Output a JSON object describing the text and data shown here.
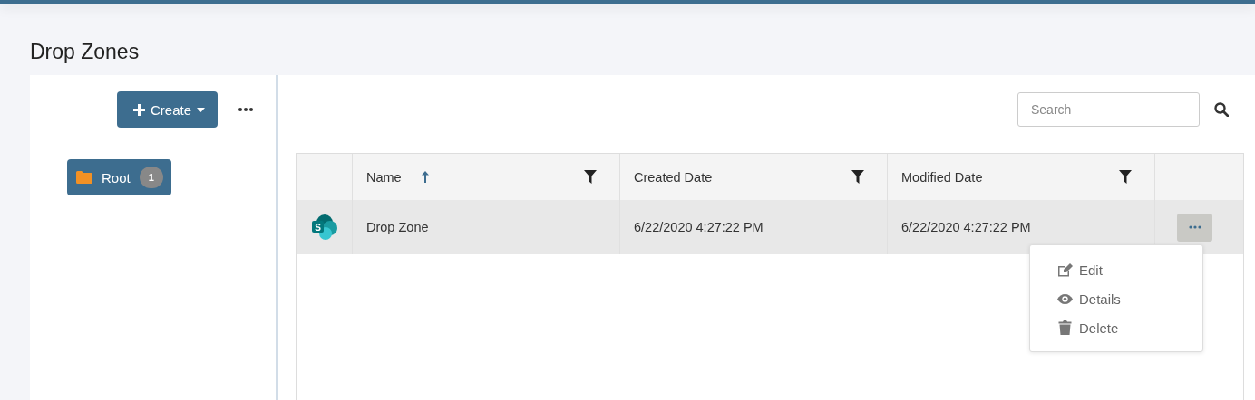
{
  "page": {
    "title": "Drop Zones"
  },
  "sidebar": {
    "create_button": "Create",
    "tree": [
      {
        "label": "Root",
        "count": "1",
        "selected": true
      }
    ]
  },
  "search": {
    "placeholder": "Search"
  },
  "table": {
    "columns": [
      {
        "label": "Name",
        "sorted": true,
        "filterable": true
      },
      {
        "label": "Created Date",
        "sorted": false,
        "filterable": true
      },
      {
        "label": "Modified Date",
        "sorted": false,
        "filterable": true
      }
    ],
    "rows": [
      {
        "icon_letter": "S",
        "name": "Drop Zone",
        "created": "6/22/2020 4:27:22 PM",
        "modified": "6/22/2020 4:27:22 PM",
        "selected": true,
        "menu_open": true
      }
    ]
  },
  "row_menu": [
    {
      "kind": "edit",
      "label": "Edit"
    },
    {
      "kind": "details",
      "label": "Details"
    },
    {
      "kind": "delete",
      "label": "Delete"
    }
  ]
}
